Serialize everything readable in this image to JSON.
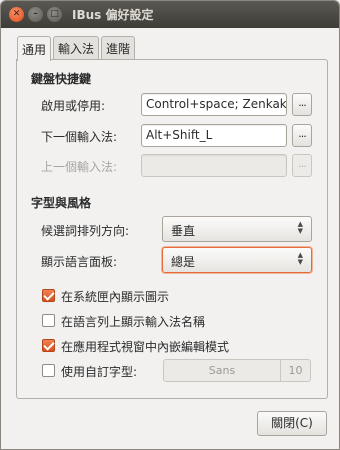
{
  "window": {
    "title": "IBus 偏好設定",
    "close_glyph": "✕",
    "min_glyph": "–",
    "max_glyph": "□"
  },
  "tabs": [
    {
      "label": "通用"
    },
    {
      "label": "輸入法"
    },
    {
      "label": "進階"
    }
  ],
  "shortcuts": {
    "title": "鍵盤快捷鍵",
    "rows": [
      {
        "label": "啟用或停用:",
        "value": "Control+space; Zenkaku_",
        "button": "..."
      },
      {
        "label": "下一個輸入法:",
        "value": "Alt+Shift_L",
        "button": "..."
      },
      {
        "label": "上一個輸入法:",
        "value": "",
        "button": "..."
      }
    ]
  },
  "style": {
    "title": "字型與風格",
    "orientation_label": "候選詞排列方向:",
    "orientation_value": "垂直",
    "panel_label": "顯示語言面板:",
    "panel_value": "總是",
    "options": [
      {
        "label": "在系統匣內顯示圖示",
        "checked": true
      },
      {
        "label": "在語言列上顯示輸入法名稱",
        "checked": false
      },
      {
        "label": "在應用程式視窗中內嵌編輯模式",
        "checked": true
      }
    ],
    "custom_font_label": "使用自訂字型:",
    "custom_font_name": "Sans",
    "custom_font_size": "10"
  },
  "footer": {
    "close_label": "關閉(C)"
  }
}
